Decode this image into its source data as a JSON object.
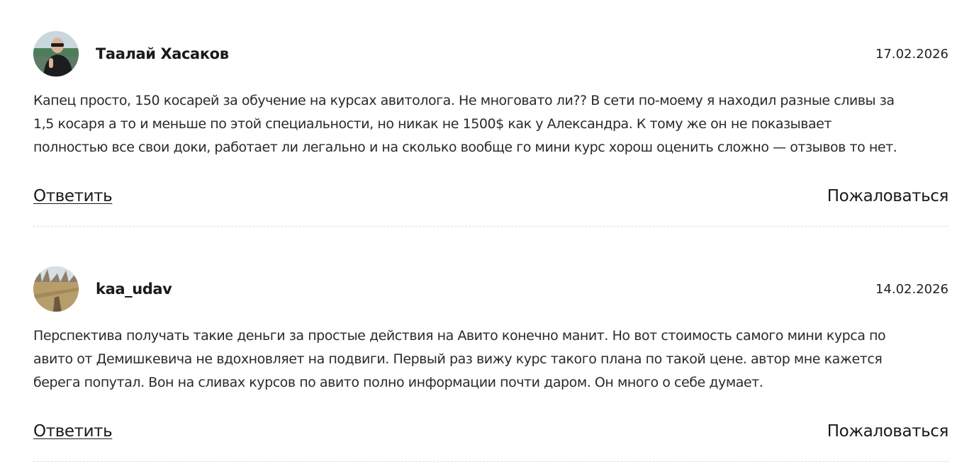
{
  "comments": [
    {
      "author": "Таалай Хасаков",
      "date": "17.02.2026",
      "text_lines": [
        "Капец просто, 150 косарей за обучение на курсах авитолога. Не многовато ли?? В сети по-моему я находил разные сливы за",
        "1,5 косаря а то и меньше по этой специальности, но никак не 1500$ как у Александра. К тому же он не показывает",
        "полностью все свои доки, работает ли легально и на сколько вообще го мини курс хорош оценить сложно — отзывов то нет."
      ],
      "reply_label": "Ответить",
      "report_label": "Пожаловаться"
    },
    {
      "author": "kaa_udav",
      "date": "14.02.2026",
      "text_lines": [
        "Перспектива получать такие деньги за простые действия на Авито конечно манит. Но вот стоимость самого мини курса по",
        "авито от Демишкевича не вдохновляет на подвиги. Первый раз вижу курс такого плана по такой цене. автор мне кажется",
        "берега попутал. Вон на сливах курсов по авито полно информации почти даром. Он много о себе думает."
      ],
      "reply_label": "Ответить",
      "report_label": "Пожаловаться"
    }
  ]
}
